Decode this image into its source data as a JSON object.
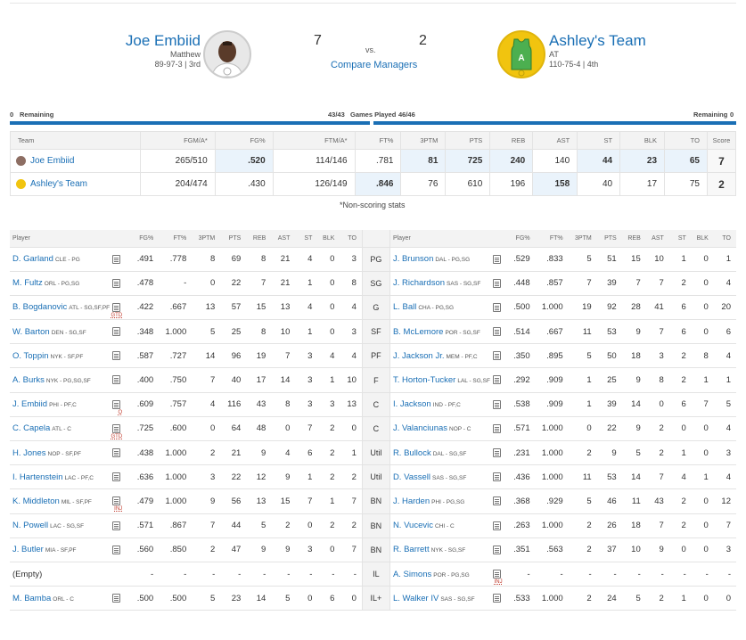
{
  "matchup": {
    "left": {
      "name": "Joe Embiid",
      "owner": "Matthew",
      "record": "89-97-3 | 3rd",
      "score": "7"
    },
    "right": {
      "name": "Ashley's Team",
      "owner": "AT",
      "record": "110-75-4 | 4th",
      "score": "2"
    },
    "vs_label": "vs.",
    "compare_label": "Compare Managers"
  },
  "games": {
    "left_remaining_count": "0",
    "left_remaining_label": "Remaining",
    "left_played": "43/43",
    "played_label": "Games Played",
    "right_played": "46/46",
    "right_remaining_label": "Remaining",
    "right_remaining_count": "0"
  },
  "summary": {
    "headers": [
      "Team",
      "FGM/A*",
      "FG%",
      "FTM/A*",
      "FT%",
      "3PTM",
      "PTS",
      "REB",
      "AST",
      "ST",
      "BLK",
      "TO",
      "Score"
    ],
    "rows": [
      {
        "team": "Joe Embiid",
        "values": [
          "265/510",
          ".520",
          "114/146",
          ".781",
          "81",
          "725",
          "240",
          "140",
          "44",
          "23",
          "65"
        ],
        "score": "7"
      },
      {
        "team": "Ashley's Team",
        "values": [
          "204/474",
          ".430",
          "126/149",
          ".846",
          "76",
          "610",
          "196",
          "158",
          "40",
          "17",
          "75"
        ],
        "score": "2"
      }
    ],
    "note": "*Non-scoring stats"
  },
  "roster": {
    "headers": [
      "Player",
      "FG%",
      "FT%",
      "3PTM",
      "PTS",
      "REB",
      "AST",
      "ST",
      "BLK",
      "TO"
    ],
    "rows": [
      {
        "slot": "PG",
        "l": {
          "name": "D. Garland",
          "meta": "CLE - PG",
          "stats": [
            ".491",
            ".778",
            "8",
            "69",
            "8",
            "21",
            "4",
            "0",
            "3"
          ]
        },
        "r": {
          "name": "J. Brunson",
          "meta": "DAL - PG,SG",
          "stats": [
            ".529",
            ".833",
            "5",
            "51",
            "15",
            "10",
            "1",
            "0",
            "1"
          ]
        }
      },
      {
        "slot": "SG",
        "l": {
          "name": "M. Fultz",
          "meta": "ORL - PG,SG",
          "stats": [
            ".478",
            "-",
            "0",
            "22",
            "7",
            "21",
            "1",
            "0",
            "8"
          ]
        },
        "r": {
          "name": "J. Richardson",
          "meta": "SAS - SG,SF",
          "stats": [
            ".448",
            ".857",
            "7",
            "39",
            "7",
            "7",
            "2",
            "0",
            "4"
          ]
        }
      },
      {
        "slot": "G",
        "l": {
          "name": "B. Bogdanovic",
          "meta": "ATL - SG,SF,PF",
          "tag": "GTD",
          "stats": [
            ".422",
            ".667",
            "13",
            "57",
            "15",
            "13",
            "4",
            "0",
            "4"
          ]
        },
        "r": {
          "name": "L. Ball",
          "meta": "CHA - PG,SG",
          "stats": [
            ".500",
            "1.000",
            "19",
            "92",
            "28",
            "41",
            "6",
            "0",
            "20"
          ]
        }
      },
      {
        "slot": "SF",
        "l": {
          "name": "W. Barton",
          "meta": "DEN - SG,SF",
          "stats": [
            ".348",
            "1.000",
            "5",
            "25",
            "8",
            "10",
            "1",
            "0",
            "3"
          ]
        },
        "r": {
          "name": "B. McLemore",
          "meta": "POR - SG,SF",
          "stats": [
            ".514",
            ".667",
            "11",
            "53",
            "9",
            "7",
            "6",
            "0",
            "6"
          ]
        }
      },
      {
        "slot": "PF",
        "l": {
          "name": "O. Toppin",
          "meta": "NYK - SF,PF",
          "stats": [
            ".587",
            ".727",
            "14",
            "96",
            "19",
            "7",
            "3",
            "4",
            "4"
          ]
        },
        "r": {
          "name": "J. Jackson Jr.",
          "meta": "MEM - PF,C",
          "stats": [
            ".350",
            ".895",
            "5",
            "50",
            "18",
            "3",
            "2",
            "8",
            "4"
          ]
        }
      },
      {
        "slot": "F",
        "l": {
          "name": "A. Burks",
          "meta": "NYK - PG,SG,SF",
          "stats": [
            ".400",
            ".750",
            "7",
            "40",
            "17",
            "14",
            "3",
            "1",
            "10"
          ]
        },
        "r": {
          "name": "T. Horton-Tucker",
          "meta": "LAL - SG,SF",
          "stats": [
            ".292",
            ".909",
            "1",
            "25",
            "9",
            "8",
            "2",
            "1",
            "1"
          ]
        }
      },
      {
        "slot": "C",
        "l": {
          "name": "J. Embiid",
          "meta": "PHI - PF,C",
          "tag": "Q",
          "stats": [
            ".609",
            ".757",
            "4",
            "116",
            "43",
            "8",
            "3",
            "3",
            "13"
          ]
        },
        "r": {
          "name": "I. Jackson",
          "meta": "IND - PF,C",
          "stats": [
            ".538",
            ".909",
            "1",
            "39",
            "14",
            "0",
            "6",
            "7",
            "5"
          ]
        }
      },
      {
        "slot": "C",
        "l": {
          "name": "C. Capela",
          "meta": "ATL - C",
          "tag": "GTD",
          "stats": [
            ".725",
            ".600",
            "0",
            "64",
            "48",
            "0",
            "7",
            "2",
            "0"
          ]
        },
        "r": {
          "name": "J. Valanciunas",
          "meta": "NOP - C",
          "stats": [
            ".571",
            "1.000",
            "0",
            "22",
            "9",
            "2",
            "0",
            "0",
            "4"
          ]
        }
      },
      {
        "slot": "Util",
        "l": {
          "name": "H. Jones",
          "meta": "NOP - SF,PF",
          "stats": [
            ".438",
            "1.000",
            "2",
            "21",
            "9",
            "4",
            "6",
            "2",
            "1"
          ]
        },
        "r": {
          "name": "R. Bullock",
          "meta": "DAL - SG,SF",
          "stats": [
            ".231",
            "1.000",
            "2",
            "9",
            "5",
            "2",
            "1",
            "0",
            "3"
          ]
        }
      },
      {
        "slot": "Util",
        "l": {
          "name": "I. Hartenstein",
          "meta": "LAC - PF,C",
          "stats": [
            ".636",
            "1.000",
            "3",
            "22",
            "12",
            "9",
            "1",
            "2",
            "2"
          ]
        },
        "r": {
          "name": "D. Vassell",
          "meta": "SAS - SG,SF",
          "stats": [
            ".436",
            "1.000",
            "11",
            "53",
            "14",
            "7",
            "4",
            "1",
            "4"
          ]
        }
      },
      {
        "slot": "BN",
        "l": {
          "name": "K. Middleton",
          "meta": "MIL - SF,PF",
          "tag": "INJ",
          "stats": [
            ".479",
            "1.000",
            "9",
            "56",
            "13",
            "15",
            "7",
            "1",
            "7"
          ]
        },
        "r": {
          "name": "J. Harden",
          "meta": "PHI - PG,SG",
          "stats": [
            ".368",
            ".929",
            "5",
            "46",
            "11",
            "43",
            "2",
            "0",
            "12"
          ]
        }
      },
      {
        "slot": "BN",
        "l": {
          "name": "N. Powell",
          "meta": "LAC - SG,SF",
          "stats": [
            ".571",
            ".867",
            "7",
            "44",
            "5",
            "2",
            "0",
            "2",
            "2"
          ]
        },
        "r": {
          "name": "N. Vucevic",
          "meta": "CHI - C",
          "stats": [
            ".263",
            "1.000",
            "2",
            "26",
            "18",
            "7",
            "2",
            "0",
            "7"
          ]
        }
      },
      {
        "slot": "BN",
        "l": {
          "name": "J. Butler",
          "meta": "MIA - SF,PF",
          "stats": [
            ".560",
            ".850",
            "2",
            "47",
            "9",
            "9",
            "3",
            "0",
            "7"
          ]
        },
        "r": {
          "name": "R. Barrett",
          "meta": "NYK - SG,SF",
          "stats": [
            ".351",
            ".563",
            "2",
            "37",
            "10",
            "9",
            "0",
            "0",
            "3"
          ]
        }
      },
      {
        "slot": "IL",
        "l": {
          "empty": "(Empty)",
          "stats": [
            "-",
            "-",
            "-",
            "-",
            "-",
            "-",
            "-",
            "-",
            "-"
          ]
        },
        "r": {
          "name": "A. Simons",
          "meta": "POR - PG,SG",
          "tag": "INJ",
          "stats": [
            "-",
            "-",
            "-",
            "-",
            "-",
            "-",
            "-",
            "-",
            "-"
          ]
        }
      },
      {
        "slot": "IL+",
        "l": {
          "name": "M. Bamba",
          "meta": "ORL - C",
          "stats": [
            ".500",
            ".500",
            "5",
            "23",
            "14",
            "5",
            "0",
            "6",
            "0"
          ]
        },
        "r": {
          "name": "L. Walker IV",
          "meta": "SAS - SG,SF",
          "stats": [
            ".533",
            "1.000",
            "2",
            "24",
            "5",
            "2",
            "1",
            "0",
            "0"
          ]
        }
      }
    ]
  },
  "colors": {
    "link": "#1a6fb5",
    "highlight": "#eaf3fb",
    "header_bg": "#f3f3f3",
    "tag": "#c0392b"
  }
}
